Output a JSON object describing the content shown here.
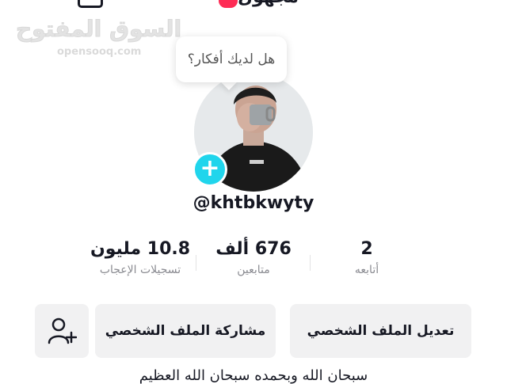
{
  "header": {
    "username_display": "مجهول"
  },
  "watermark": {
    "arabic": "السوق المفتوح",
    "latin": "opensooq.com"
  },
  "bubble": {
    "text": "هل لديك أفكار؟"
  },
  "profile": {
    "handle": "@khtbkwyty"
  },
  "stats": {
    "following": {
      "value": "2",
      "label": "أتابعه"
    },
    "followers": {
      "value": "676 ألف",
      "label": "متابعين"
    },
    "likes": {
      "value": "10.8 مليون",
      "label": "تسجيلات الإعجاب"
    }
  },
  "actions": {
    "edit_profile": "تعديل الملف الشخصي",
    "share_profile": "مشاركة الملف الشخصي"
  },
  "icons": {
    "menu": "menu-icon",
    "profile_view": "profile-view-icon",
    "add_story": "plus-icon",
    "add_friend": "add-friend-icon"
  },
  "colors": {
    "accent_cyan": "#20d5ec",
    "accent_red": "#fe2c55",
    "button_bg": "#f1f1f2",
    "secondary_text": "#8a8b91"
  },
  "bio": {
    "text": "سبحان الله وبحمده سبحان الله العظيم"
  }
}
